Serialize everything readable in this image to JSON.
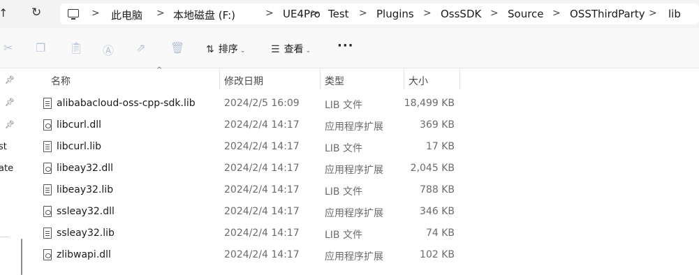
{
  "address_bar": {
    "crumbs": [
      "此电脑",
      "本地磁盘 (F:)",
      "UE4Pro",
      "Test",
      "Plugins",
      "OssSDK",
      "Source",
      "OSSThirdParty",
      "lib"
    ],
    "separator": ">",
    "up_glyph": "↑",
    "refresh_glyph": "↻"
  },
  "toolbar": {
    "icons": [
      "cut-icon",
      "copy-icon",
      "paste-icon",
      "rename-icon",
      "share-icon",
      "delete-icon"
    ],
    "sort_label": "排序",
    "view_label": "查看",
    "more_label": "···"
  },
  "nav_pane": {
    "partial_items": [
      "st",
      "ate"
    ]
  },
  "columns": {
    "name": "名称",
    "modified": "修改日期",
    "type": "类型",
    "size": "大小"
  },
  "files": [
    {
      "name": "alibabacloud-oss-cpp-sdk.lib",
      "modified": "2024/2/5 16:09",
      "type": "LIB 文件",
      "size": "18,499 KB",
      "kind": "lib"
    },
    {
      "name": "libcurl.dll",
      "modified": "2024/2/4 14:17",
      "type": "应用程序扩展",
      "size": "369 KB",
      "kind": "dll"
    },
    {
      "name": "libcurl.lib",
      "modified": "2024/2/4 14:17",
      "type": "LIB 文件",
      "size": "17 KB",
      "kind": "lib"
    },
    {
      "name": "libeay32.dll",
      "modified": "2024/2/4 14:17",
      "type": "应用程序扩展",
      "size": "2,045 KB",
      "kind": "dll"
    },
    {
      "name": "libeay32.lib",
      "modified": "2024/2/4 14:17",
      "type": "LIB 文件",
      "size": "788 KB",
      "kind": "lib"
    },
    {
      "name": "ssleay32.dll",
      "modified": "2024/2/4 14:17",
      "type": "应用程序扩展",
      "size": "346 KB",
      "kind": "dll"
    },
    {
      "name": "ssleay32.lib",
      "modified": "2024/2/4 14:17",
      "type": "LIB 文件",
      "size": "74 KB",
      "kind": "lib"
    },
    {
      "name": "zlibwapi.dll",
      "modified": "2024/2/4 14:17",
      "type": "应用程序扩展",
      "size": "102 KB",
      "kind": "dll"
    }
  ]
}
